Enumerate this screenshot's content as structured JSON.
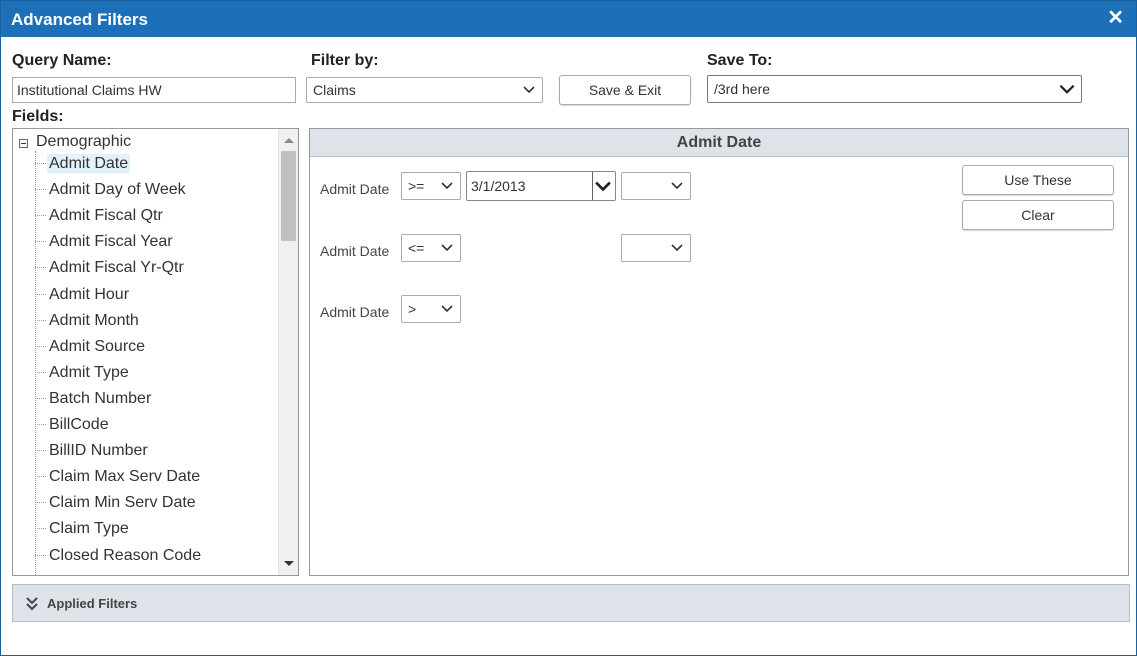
{
  "dialog": {
    "title": "Advanced Filters",
    "close_glyph": "✕"
  },
  "query": {
    "label": "Query Name:",
    "value": "Institutional Claims HW"
  },
  "filter_by": {
    "label": "Filter by:",
    "value": "Claims"
  },
  "save_exit_label": "Save & Exit",
  "save_to": {
    "label": "Save To:",
    "value": "/3rd here"
  },
  "fields": {
    "label": "Fields:",
    "group": "Demographic",
    "items": [
      "Admit Date",
      "Admit Day of Week",
      "Admit Fiscal Qtr",
      "Admit Fiscal Year",
      "Admit Fiscal Yr-Qtr",
      "Admit Hour",
      "Admit Month",
      "Admit Source",
      "Admit Type",
      "Batch Number",
      "BillCode",
      "BillID Number",
      "Claim Max Serv Date",
      "Claim Min Serv Date",
      "Claim Type",
      "Closed Reason Code"
    ],
    "selected": "Admit Date"
  },
  "panel": {
    "title": "Admit Date",
    "rows": [
      {
        "label": "Admit Date",
        "operator": ">=",
        "value": "3/1/2013",
        "third": ""
      },
      {
        "label": "Admit Date",
        "operator": "<=",
        "third": ""
      },
      {
        "label": "Admit Date",
        "operator": ">"
      }
    ],
    "use_these_label": "Use These",
    "clear_label": "Clear"
  },
  "applied_filters_label": "Applied Filters",
  "colors": {
    "titlebar": "#1c70b7",
    "panel_header": "#dde3e8",
    "selected_bg": "#e2f2fb"
  },
  "icons": {
    "close": "close-icon",
    "collapse": "minus-box-icon",
    "expand": "double-chevron-down-icon",
    "dropdown": "chevron-down-icon"
  }
}
